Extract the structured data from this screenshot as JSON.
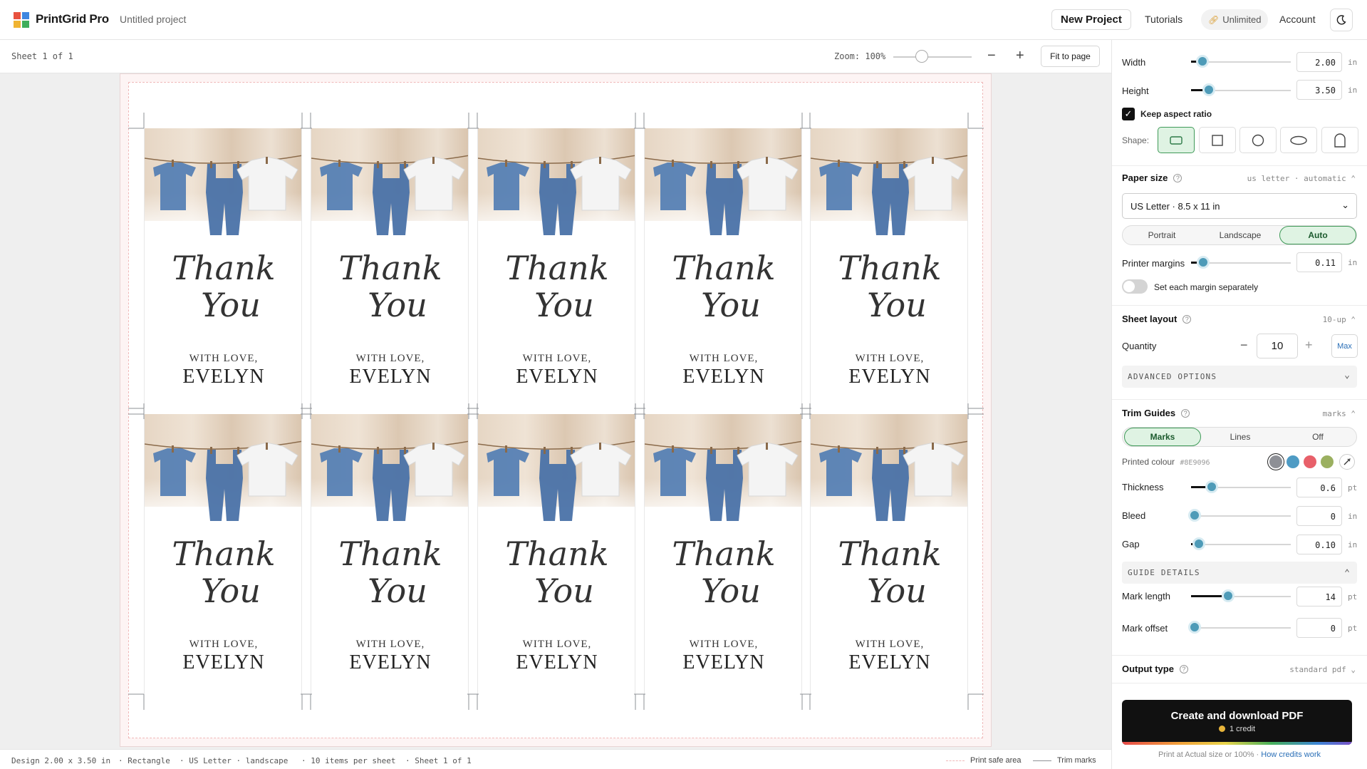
{
  "app": {
    "brand": "PrintGrid Pro",
    "project_name": "Untitled project"
  },
  "header": {
    "new_project": "New Project",
    "tutorials": "Tutorials",
    "unlimited": "Unlimited",
    "account": "Account"
  },
  "toolbar": {
    "sheet_label": "Sheet 1 of 1",
    "zoom_label": "Zoom: 100%",
    "zoom_value": 100,
    "fit_to_page": "Fit to page"
  },
  "card": {
    "script_line1": "Thank",
    "script_line2": "You",
    "with_love": "WITH LOVE,",
    "name": "EVELYN"
  },
  "status": {
    "design": "Design 2.00 x 3.50 in",
    "shape": "· Rectangle",
    "paper": "· US Letter · landscape",
    "items": "· 10 items per sheet",
    "sheet": "· Sheet 1 of 1",
    "legend_safe": "Print safe area",
    "legend_trim": "Trim marks"
  },
  "panel": {
    "width_label": "Width",
    "width_value": "2.00",
    "width_unit": "in",
    "height_label": "Height",
    "height_value": "3.50",
    "height_unit": "in",
    "keep_aspect": "Keep aspect ratio",
    "shape_label": "Shape:",
    "paper_size": {
      "title": "Paper size",
      "summary": "us letter · automatic",
      "selected": "US Letter · 8.5 x 11 in",
      "orientation": [
        "Portrait",
        "Landscape",
        "Auto"
      ],
      "orientation_active": "Auto"
    },
    "printer_margins": {
      "label": "Printer margins",
      "value": "0.11",
      "unit": "in"
    },
    "margin_toggle": "Set each margin separately",
    "sheet_layout": {
      "title": "Sheet layout",
      "summary": "10-up",
      "quantity_label": "Quantity",
      "quantity": "10",
      "max": "Max",
      "advanced": "ADVANCED OPTIONS"
    },
    "trim_guides": {
      "title": "Trim Guides",
      "summary": "marks",
      "modes": [
        "Marks",
        "Lines",
        "Off"
      ],
      "mode_active": "Marks",
      "printed_colour_label": "Printed colour",
      "printed_colour_hex": "#8E9096",
      "swatches": [
        "#8E9096",
        "#4e9bc4",
        "#e8606a",
        "#9bb060"
      ],
      "thickness": {
        "label": "Thickness",
        "value": "0.6",
        "unit": "pt"
      },
      "bleed": {
        "label": "Bleed",
        "value": "0",
        "unit": "in"
      },
      "gap": {
        "label": "Gap",
        "value": "0.10",
        "unit": "in"
      },
      "guide_details": "GUIDE DETAILS",
      "mark_length": {
        "label": "Mark length",
        "value": "14",
        "unit": "pt"
      },
      "mark_offset": {
        "label": "Mark offset",
        "value": "0",
        "unit": "pt"
      }
    },
    "output_type": {
      "title": "Output type",
      "summary": "standard pdf"
    },
    "create": {
      "title": "Create and download PDF",
      "credit": "1 credit"
    },
    "footnote": "Print at Actual size or 100% ·",
    "footnote_link": "How credits work"
  },
  "colors": {
    "accent_green": "#3f9a58",
    "slider_knob": "#4e9bb8",
    "safe_area": "#f0b8b8"
  }
}
